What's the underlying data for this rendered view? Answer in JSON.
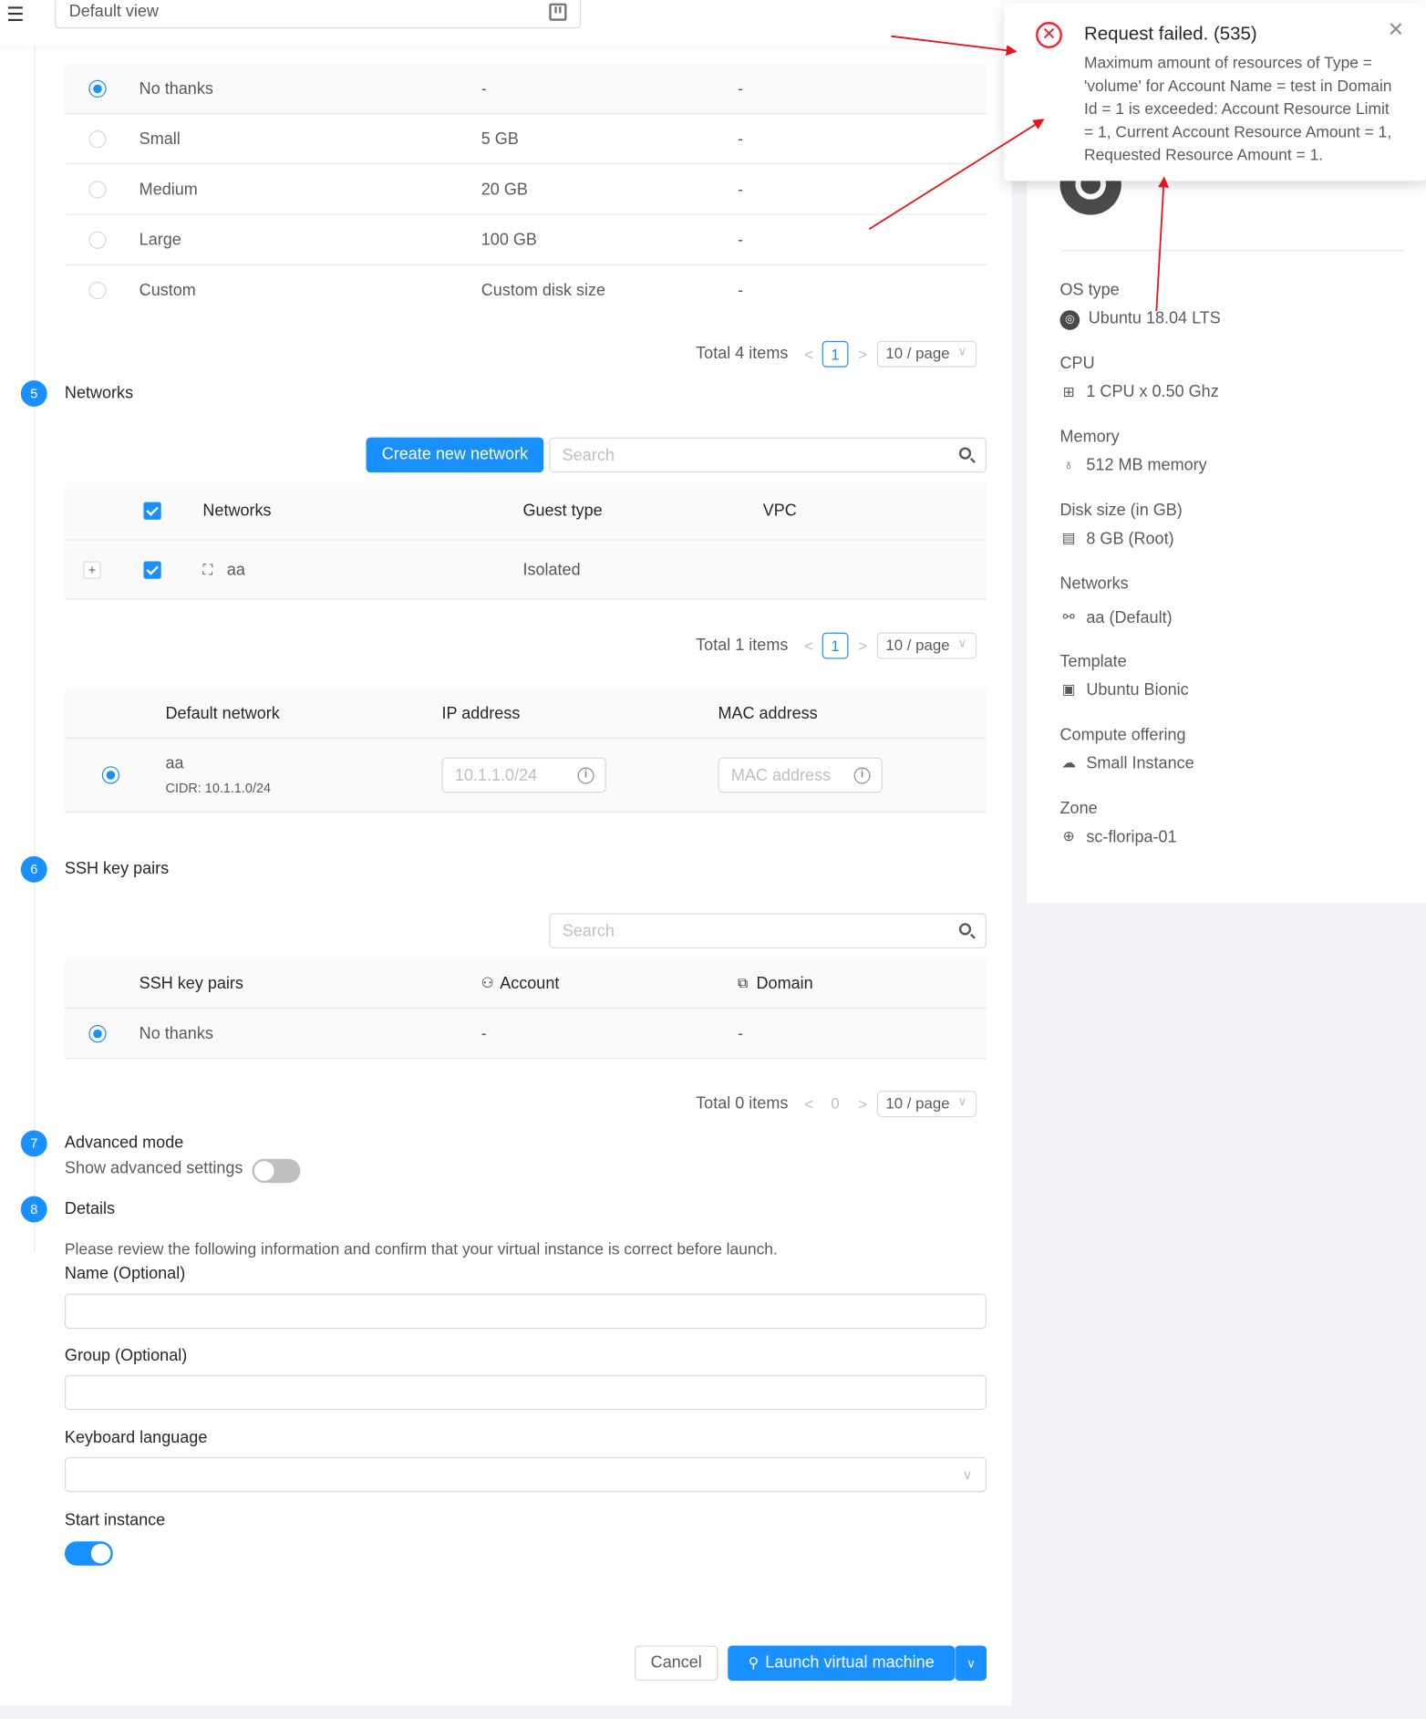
{
  "topbar": {
    "view_select": "Default view"
  },
  "disk_table": {
    "rows": [
      {
        "name": "No thanks",
        "size": "-",
        "extra": "-"
      },
      {
        "name": "Small",
        "size": "5 GB",
        "extra": "-"
      },
      {
        "name": "Medium",
        "size": "20 GB",
        "extra": "-"
      },
      {
        "name": "Large",
        "size": "100 GB",
        "extra": "-"
      },
      {
        "name": "Custom",
        "size": "Custom disk size",
        "extra": "-"
      }
    ],
    "pager": {
      "total": "Total 4 items",
      "page": "1",
      "size": "10 / page"
    }
  },
  "steps": {
    "networks": {
      "num": "5",
      "title": "Networks"
    },
    "ssh": {
      "num": "6",
      "title": "SSH key pairs"
    },
    "advanced": {
      "num": "7",
      "title": "Advanced mode",
      "sub": "Show advanced settings"
    },
    "details": {
      "num": "8",
      "title": "Details"
    }
  },
  "networks": {
    "create_button": "Create new network",
    "search_placeholder": "Search",
    "headers": {
      "name": "Networks",
      "guest": "Guest type",
      "vpc": "VPC"
    },
    "rows": [
      {
        "name": "aa",
        "guest": "Isolated",
        "vpc": ""
      }
    ],
    "pager": {
      "total": "Total 1 items",
      "page": "1",
      "size": "10 / page"
    },
    "default_table": {
      "headers": {
        "default": "Default network",
        "ip": "IP address",
        "mac": "MAC address"
      },
      "row": {
        "name": "aa",
        "cidr": "CIDR: 10.1.1.0/24",
        "ip_placeholder": "10.1.1.0/24",
        "mac_placeholder": "MAC address"
      }
    }
  },
  "ssh": {
    "search_placeholder": "Search",
    "headers": {
      "name": "SSH key pairs",
      "account": "Account",
      "domain": "Domain"
    },
    "rows": [
      {
        "name": "No thanks",
        "account": "-",
        "domain": "-"
      }
    ],
    "pager": {
      "total": "Total 0 items",
      "page": "0",
      "size": "10 / page"
    }
  },
  "details": {
    "intro": "Please review the following information and confirm that your virtual instance is correct before launch.",
    "name_label": "Name (Optional)",
    "group_label": "Group (Optional)",
    "keyboard_label": "Keyboard language",
    "start_label": "Start instance",
    "start_on": true,
    "advanced_on": false
  },
  "footer": {
    "cancel": "Cancel",
    "launch": "Launch virtual machine"
  },
  "summary": {
    "os_type_label": "OS type",
    "os_type": "Ubuntu 18.04 LTS",
    "cpu_label": "CPU",
    "cpu": "1 CPU x 0.50 Ghz",
    "memory_label": "Memory",
    "memory": "512 MB memory",
    "disk_label": "Disk size (in GB)",
    "disk": "8 GB (Root)",
    "networks_label": "Networks",
    "networks": "aa (Default)",
    "template_label": "Template",
    "template": "Ubuntu Bionic",
    "compute_label": "Compute offering",
    "compute": "Small Instance",
    "zone_label": "Zone",
    "zone": "sc-floripa-01"
  },
  "notification": {
    "title": "Request failed. (535)",
    "message": "Maximum amount of resources of Type = 'volume' for Account Name = test in Domain Id = 1 is exceeded: Account Resource Limit = 1, Current Account Resource Amount = 1, Requested Resource Amount = 1."
  },
  "colors": {
    "primary": "#1890ff",
    "error": "#f5222d",
    "annotation": "#e8141b"
  }
}
